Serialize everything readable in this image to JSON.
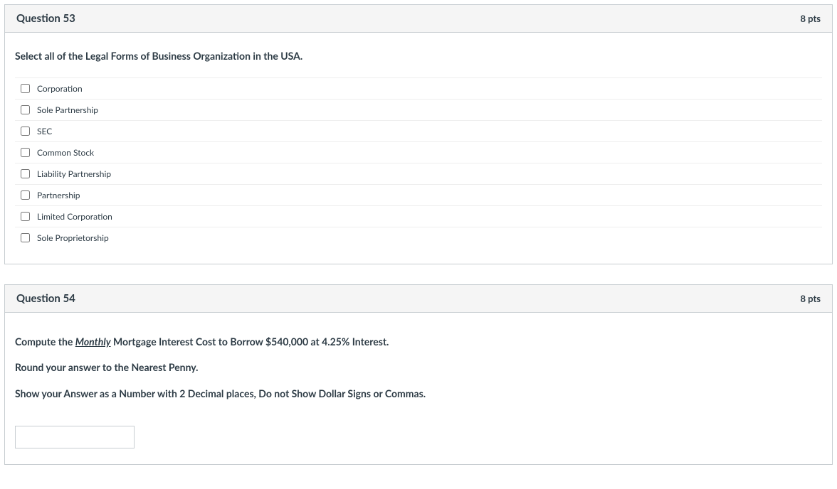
{
  "q53": {
    "title": "Question 53",
    "points": "8 pts",
    "prompt": "Select all of the Legal Forms of Business Organization in the USA.",
    "options": [
      "Corporation",
      "Sole Partnership",
      "SEC",
      "Common Stock",
      "Liability Partnership",
      "Partnership",
      "Limited Corporation",
      "Sole Proprietorship"
    ]
  },
  "q54": {
    "title": "Question 54",
    "points": "8 pts",
    "prompt_prefix": "Compute the ",
    "prompt_monthly": "Monthly",
    "prompt_suffix": " Mortgage Interest Cost to Borrow $540,000 at 4.25% Interest.",
    "line2": "Round your answer to the Nearest Penny.",
    "line3": "Show your Answer as a Number with 2 Decimal places, Do not Show Dollar Signs or Commas.",
    "answer_value": ""
  }
}
